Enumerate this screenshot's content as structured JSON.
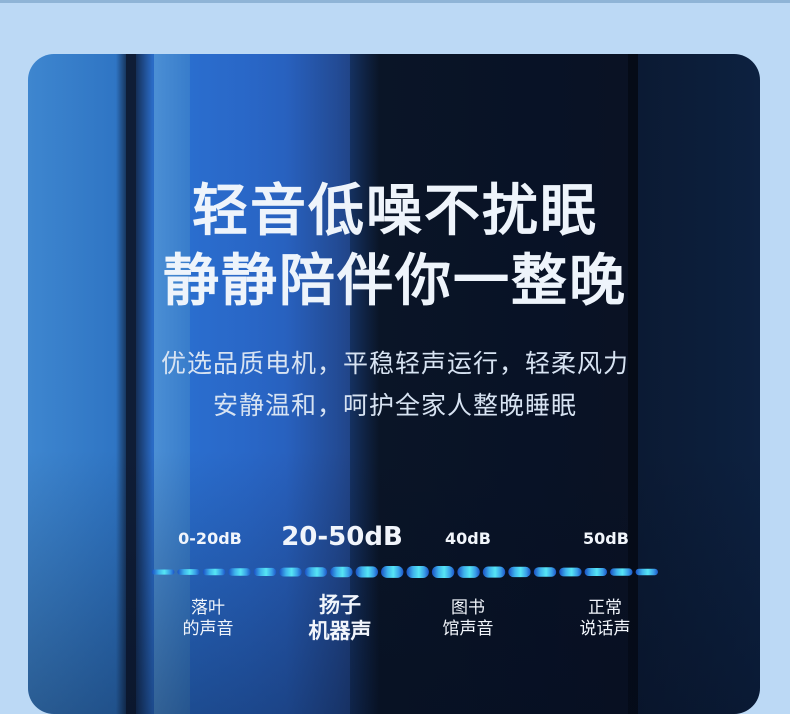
{
  "headline": {
    "line1": "轻音低噪不扰眠",
    "line2": "静静陪伴你一整晚"
  },
  "subtitle": {
    "line1": "优选品质电机，平稳轻声运行，轻柔风力",
    "line2": "安静温和，呵护全家人整晚睡眠"
  },
  "noise_scale": {
    "levels": [
      "0-20dB",
      "20-50dB",
      "40dB",
      "50dB"
    ],
    "captions": [
      [
        "落叶",
        "的声音"
      ],
      [
        "扬子",
        "机器声"
      ],
      [
        "图书",
        "馆声音"
      ],
      [
        "正常",
        "说话声"
      ]
    ],
    "highlighted_index": 1
  },
  "colors": {
    "meter_start": "#1f5fd8",
    "meter_mid": "#4fe0f2",
    "meter_end": "#2a6fd6"
  }
}
